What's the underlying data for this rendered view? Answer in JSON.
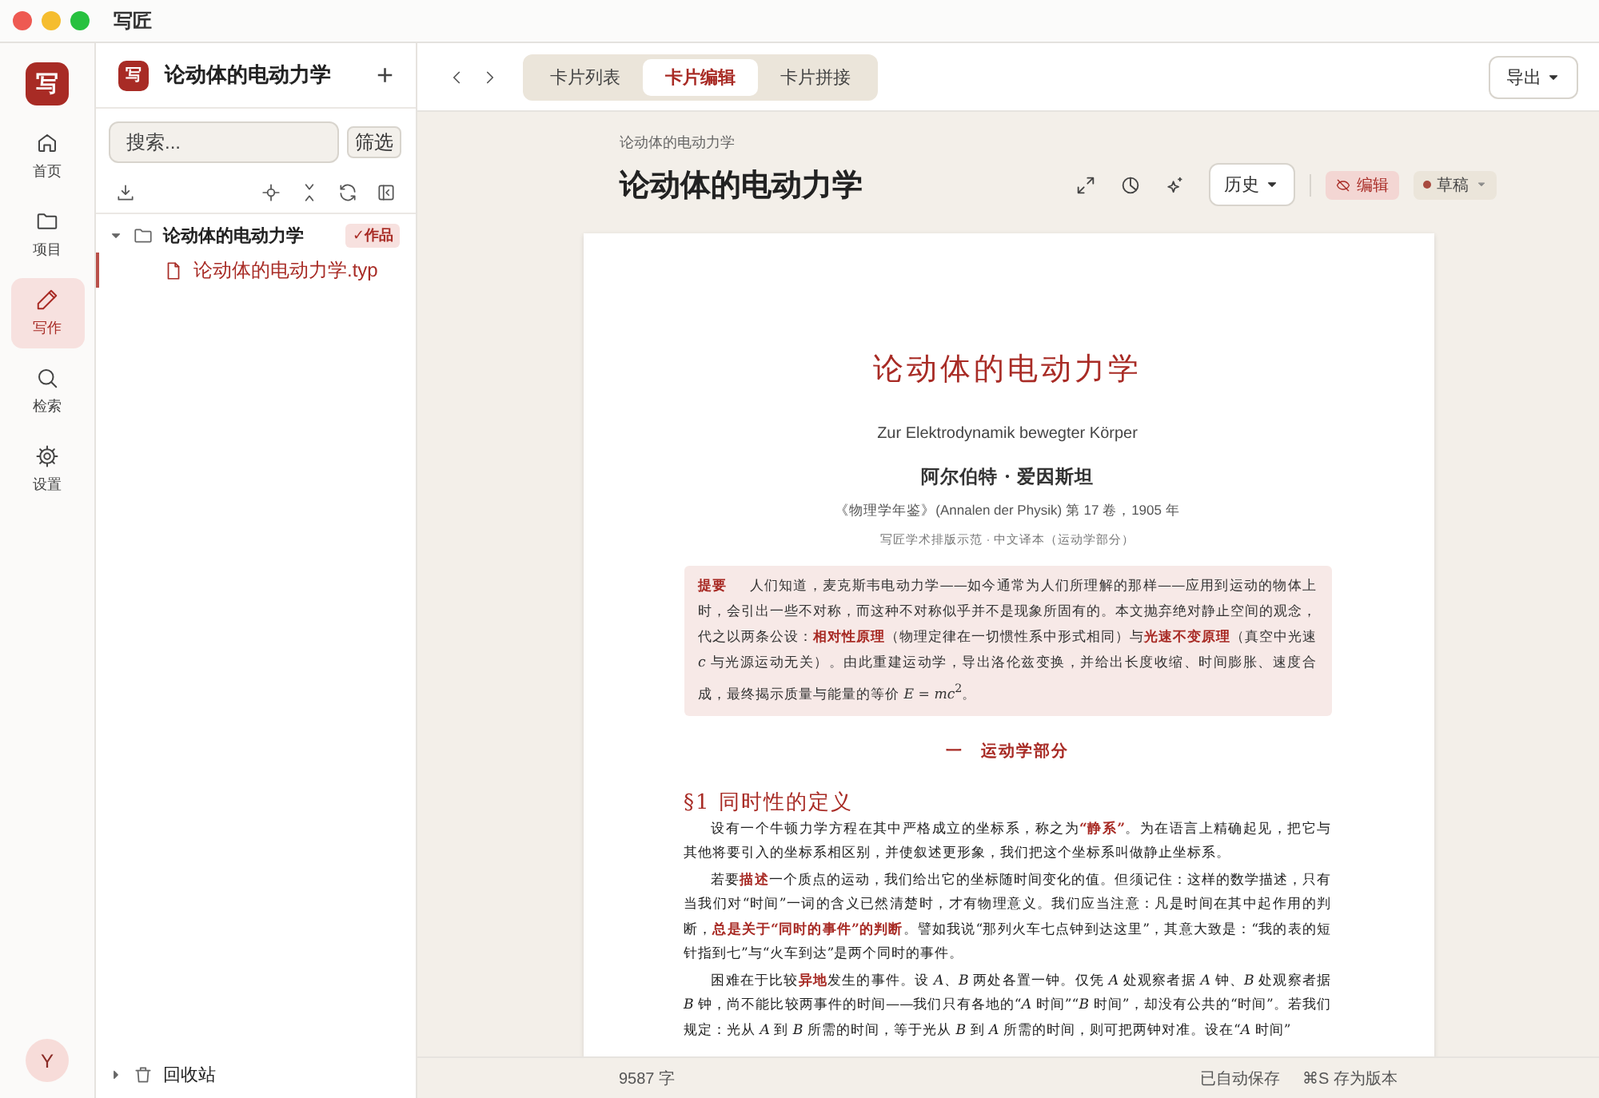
{
  "window": {
    "title": "写匠"
  },
  "rail": {
    "logo": "写",
    "items": [
      {
        "label": "首页",
        "selected": false
      },
      {
        "label": "项目",
        "selected": false
      },
      {
        "label": "写作",
        "selected": true
      },
      {
        "label": "检索",
        "selected": false
      },
      {
        "label": "设置",
        "selected": false
      }
    ],
    "avatar": "Y"
  },
  "sidebar": {
    "logo": "写",
    "project": "论动体的电动力学",
    "add": "+",
    "search": {
      "placeholder": "搜索..."
    },
    "filter": "筛选",
    "tree": [
      {
        "label": "论动体的电动力学",
        "kind": "folder",
        "expanded": true,
        "badge": "✓作品",
        "children": [
          {
            "label": "论动体的电动力学.typ",
            "kind": "file",
            "selected": true
          }
        ]
      }
    ],
    "trash": {
      "label": "回收站",
      "expanded": false
    }
  },
  "toolbar": {
    "tabs": [
      {
        "label": "卡片列表",
        "selected": false
      },
      {
        "label": "卡片编辑",
        "selected": true
      },
      {
        "label": "卡片拼接",
        "selected": false
      }
    ],
    "export": "导出"
  },
  "header": {
    "breadcrumb": "论动体的电动力学",
    "title": "论动体的电动力学",
    "history": "历史",
    "mode": "编辑",
    "status": "草稿"
  },
  "document": {
    "title": "论动体的电动力学",
    "subtitle": "Zur Elektrodynamik bewegter Körper",
    "author": "阿尔伯特 · 爱因斯坦",
    "journal": "《物理学年鉴》(Annalen der Physik) 第 17 卷，1905 年",
    "note": "写匠学术排版示范 · 中文译本（运动学部分）",
    "abstract": {
      "label": "提要",
      "text": "人们知道，麦克斯韦电动力学——如今通常为人们所理解的那样——应用到运动的物体上时，会引出一些不对称，而这种不对称似乎并不是现象所固有的。本文抛弃绝对静止空间的观念，代之以两条公设：**相对性原理**（物理定律在一切惯性系中形式相同）与**光速不变原理**（真空中光速 *c* 与光源运动无关）。由此重建运动学，导出洛伦兹变换，并给出长度收缩、时间膨胀、速度合成，最终揭示质量与能量的等价 *E* = *mc*$^{2}$。"
    },
    "section": "一　运动学部分",
    "subsection": "§1 同时性的定义",
    "paragraphs": [
      "设有一个牛顿力学方程在其中严格成立的坐标系，称之为**“静系”**。为在语言上精确起见，把它与其他将要引入的坐标系相区别，并使叙述更形象，我们把这个坐标系叫做静止坐标系。",
      "若要**描述**一个质点的运动，我们给出它的坐标随时间变化的值。但须记住：这样的数学描述，只有当我们对“时间”一词的含义已然清楚时，才有物理意义。我们应当注意：凡是时间在其中起作用的判断，**总是关于“同时的事件”的判断**。譬如我说“那列火车七点钟到达这里”，其意大致是：“我的表的短针指到七”与“火车到达”是两个同时的事件。",
      "困难在于比较**异地**发生的事件。设 *A*、*B* 两处各置一钟。仅凭 *A* 处观察者据 *A* 钟、*B* 处观察者据 *B* 钟，尚不能比较两事件的时间——我们只有各地的“*A* 时间”“*B* 时间”，却没有公共的“时间”。若我们规定：光从 *A* 到 *B* 所需的时间，等于光从 *B* 到 *A* 所需的时间，则可把两钟对准。设在“*A* 时间”"
    ]
  },
  "status_bar": {
    "words": "9587 字",
    "saved": "已自动保存",
    "shortcut": "⌘S 存为版本"
  }
}
